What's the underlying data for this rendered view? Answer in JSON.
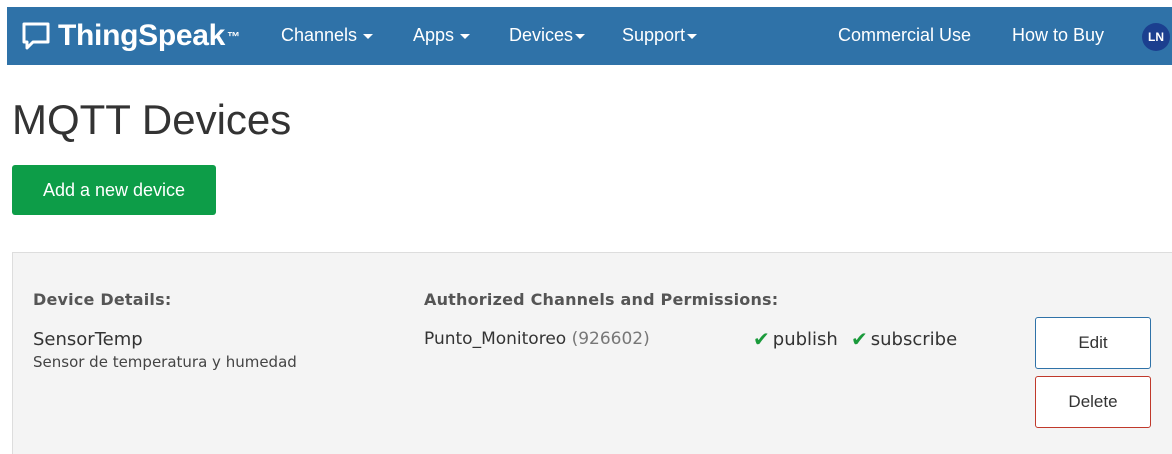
{
  "navbar": {
    "brand": "ThingSpeak",
    "brand_tm": "™",
    "menu": [
      {
        "label": "Channels"
      },
      {
        "label": "Apps"
      },
      {
        "label": "Devices"
      },
      {
        "label": "Support"
      }
    ],
    "right_links": [
      {
        "label": "Commercial Use"
      },
      {
        "label": "How to Buy"
      }
    ],
    "avatar_initials": "LN"
  },
  "page": {
    "title": "MQTT Devices",
    "add_button_label": "Add a new device"
  },
  "device": {
    "details_label": "Device Details:",
    "channels_label": "Authorized Channels and Permissions:",
    "name": "SensorTemp",
    "description": "Sensor de temperatura y humedad",
    "channel_name": "Punto_Monitoreo",
    "channel_id": "(926602)",
    "permissions": [
      {
        "label": "publish"
      },
      {
        "label": "subscribe"
      }
    ],
    "edit_label": "Edit",
    "delete_label": "Delete"
  },
  "colors": {
    "navbar": "#2f72a8",
    "add_button": "#0d9d48",
    "check": "#1a9a3b",
    "delete_border": "#c0392b"
  }
}
